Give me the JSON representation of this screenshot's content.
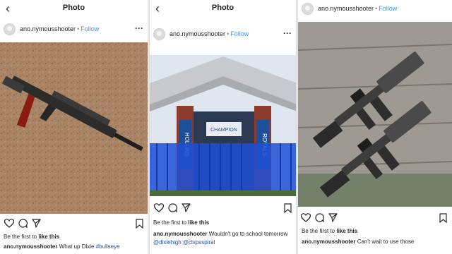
{
  "panels": [
    {
      "title": "Photo",
      "username": "ano.nymousshooter",
      "follow": "Follow",
      "likes_prefix": "Be the first to ",
      "likes_action": "like this",
      "caption_user": "ano.nymousshooter",
      "caption_text": "What up Dixie ",
      "caption_tags": "#bullseye"
    },
    {
      "title": "Photo",
      "username": "ano.nymousshooter",
      "follow": "Follow",
      "photo_sign": "CHAMPION",
      "photo_left_banner": "HOLLINS",
      "photo_right_banner": "ROYALS",
      "likes_prefix": "Be the first to ",
      "likes_action": "like this",
      "caption_user": "ano.nymousshooter",
      "caption_text": "Wouldn't go to school tomorrow",
      "caption_tags": "@dixiehigh @clxpsspiral"
    },
    {
      "username": "ano.nymousshooter",
      "follow": "Follow",
      "likes_prefix": "Be the first to ",
      "likes_action": "like this",
      "caption_user": "ano.nymousshooter",
      "caption_text": "Can't wait to use those"
    }
  ],
  "colors": {
    "follow_link": "#3897f0",
    "hashtag": "#1d4f9a",
    "text": "#262626"
  },
  "icons": [
    "back-arrow-icon",
    "more-options-icon",
    "heart-icon",
    "comment-icon",
    "share-icon",
    "bookmark-icon"
  ]
}
